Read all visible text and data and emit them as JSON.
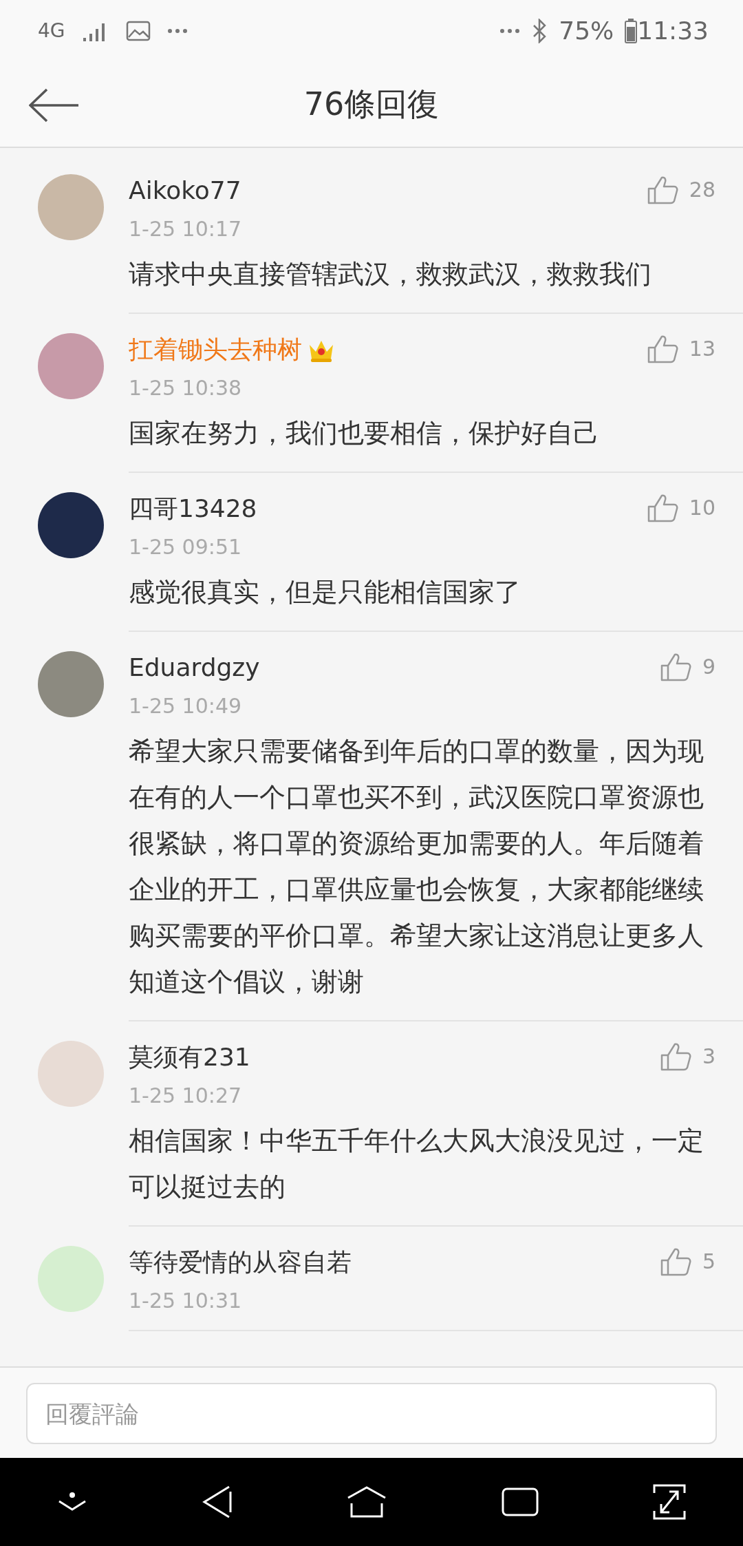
{
  "status_bar": {
    "network": "4G",
    "battery": "75%",
    "time": "11:33"
  },
  "header": {
    "title": "76條回復"
  },
  "comments": [
    {
      "user": "Aikoko77",
      "vip": false,
      "time": "1-25 10:17",
      "likes": "28",
      "text": "请求中央直接管辖武汉，救救武汉，救救我们"
    },
    {
      "user": "扛着锄头去种树",
      "vip": true,
      "time": "1-25 10:38",
      "likes": "13",
      "text": "国家在努力，我们也要相信，保护好自己"
    },
    {
      "user": "四哥13428",
      "vip": false,
      "time": "1-25 09:51",
      "likes": "10",
      "text": "感觉很真实，但是只能相信国家了"
    },
    {
      "user": "Eduardgzy",
      "vip": false,
      "time": "1-25 10:49",
      "likes": "9",
      "text": "希望大家只需要储备到年后的口罩的数量，因为现在有的人一个口罩也买不到，武汉医院口罩资源也很紧缺，将口罩的资源给更加需要的人。年后随着企业的开工，口罩供应量也会恢复，大家都能继续购买需要的平价口罩。希望大家让这消息让更多人知道这个倡议，谢谢"
    },
    {
      "user": "莫须有231",
      "vip": false,
      "time": "1-25 10:27",
      "likes": "3",
      "text": "相信国家！中华五千年什么大风大浪没见过，一定可以挺过去的"
    },
    {
      "user": "等待爱情的从容自若",
      "vip": false,
      "time": "1-25 10:31",
      "likes": "5"
    }
  ],
  "reply_bar": {
    "placeholder": "回覆評論"
  }
}
